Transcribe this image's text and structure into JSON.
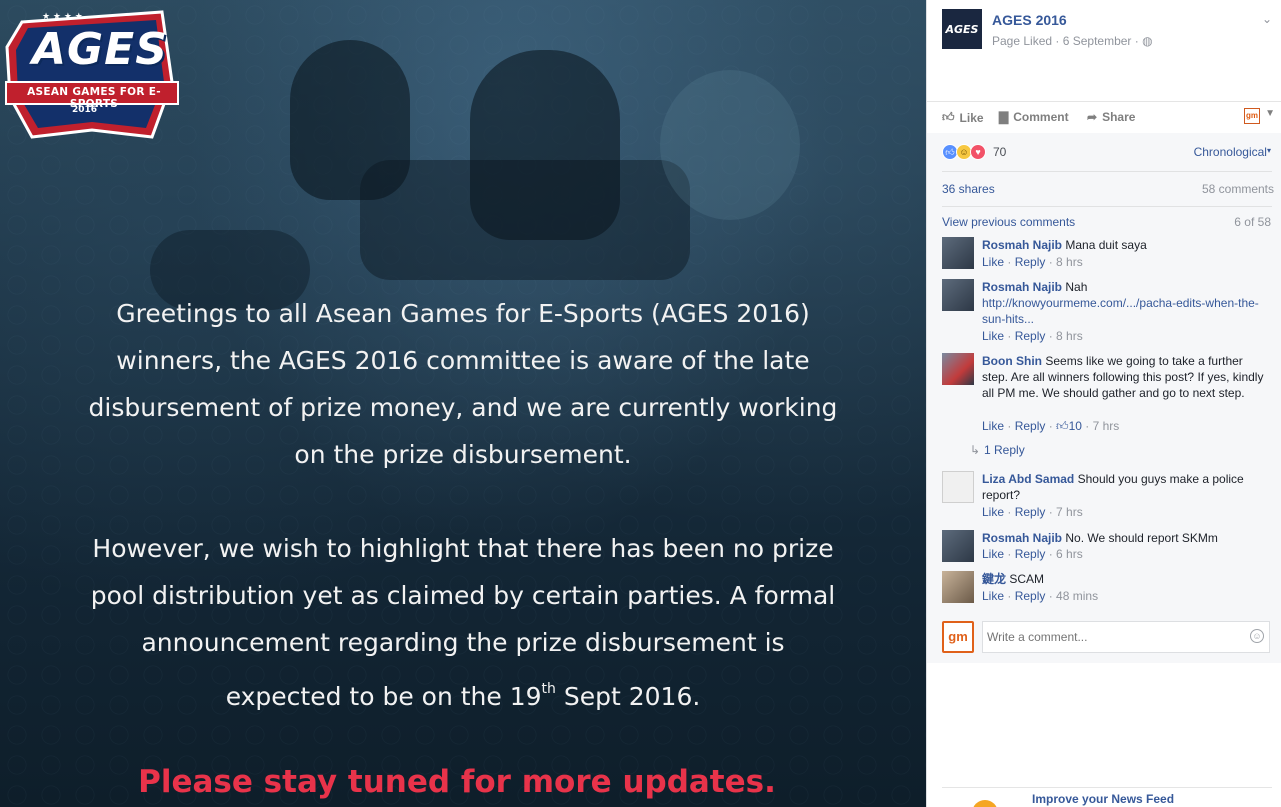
{
  "image": {
    "logo": {
      "title": "AGES",
      "subtitle": "ASEAN GAMES FOR E-SPORTS",
      "year": "2016"
    },
    "paragraph1_lines": [
      "Greetings to all Asean Games for E-Sports (AGES 2016)",
      "winners, the AGES 2016 committee is aware of the late",
      "disbursement of prize money, and we are currently working",
      "on the prize disbursement."
    ],
    "paragraph2_lines": [
      "However, we wish to highlight that there has been no prize",
      "pool distribution yet as claimed by certain parties. A formal",
      "announcement regarding the prize disbursement is"
    ],
    "last_line_before": "expected to be on the 19",
    "last_line_sup": "th",
    "last_line_after": " Sept 2016.",
    "tagline": "Please stay tuned for more updates."
  },
  "post": {
    "page_name": "AGES 2016",
    "page_avatar_text": "AGES",
    "meta": "Page Liked · 6 September · ",
    "globe_icon": "globe-icon"
  },
  "actions": {
    "like": "Like",
    "comment": "Comment",
    "share": "Share",
    "gm_badge": "gm"
  },
  "reactions": {
    "count": "70",
    "order_label": "Chronological"
  },
  "stats": {
    "shares": "36 shares",
    "comments": "58 comments"
  },
  "view_previous": "View previous comments",
  "page_counter": "6 of 58",
  "comments": [
    {
      "name": "Rosmah Najib",
      "text": "Mana duit saya",
      "like": "Like",
      "reply": "Reply",
      "time": "8 hrs"
    },
    {
      "name": "Rosmah Najib",
      "text": "Nah",
      "link": "http://knowyourmeme.com/.../pacha-edits-when-the-sun-hits...",
      "like": "Like",
      "reply": "Reply",
      "time": "8 hrs"
    },
    {
      "name": "Boon Shin",
      "text": "Seems like we going to take a further step. Are all winners following this post? If yes, kindly all PM me. We should gather and go to next step.",
      "like": "Like",
      "reply": "Reply",
      "likes": "10",
      "time": "7 hrs",
      "replies_label": "1 Reply"
    },
    {
      "name": "Liza Abd Samad",
      "text": "Should you guys make a police report?",
      "like": "Like",
      "reply": "Reply",
      "time": "7 hrs"
    },
    {
      "name": "Rosmah Najib",
      "text": "No. We should report SKMm",
      "like": "Like",
      "reply": "Reply",
      "time": "6 hrs"
    },
    {
      "name": "鍵龙",
      "text": "SCAM",
      "like": "Like",
      "reply": "Reply",
      "time": "48 mins"
    }
  ],
  "write_comment": {
    "avatar": "gm",
    "placeholder": "Write a comment..."
  },
  "footer": {
    "improve": "Improve your News Feed"
  },
  "colors": {
    "link": "#365899",
    "tagline": "#e8334a",
    "meta": "#90949c"
  }
}
